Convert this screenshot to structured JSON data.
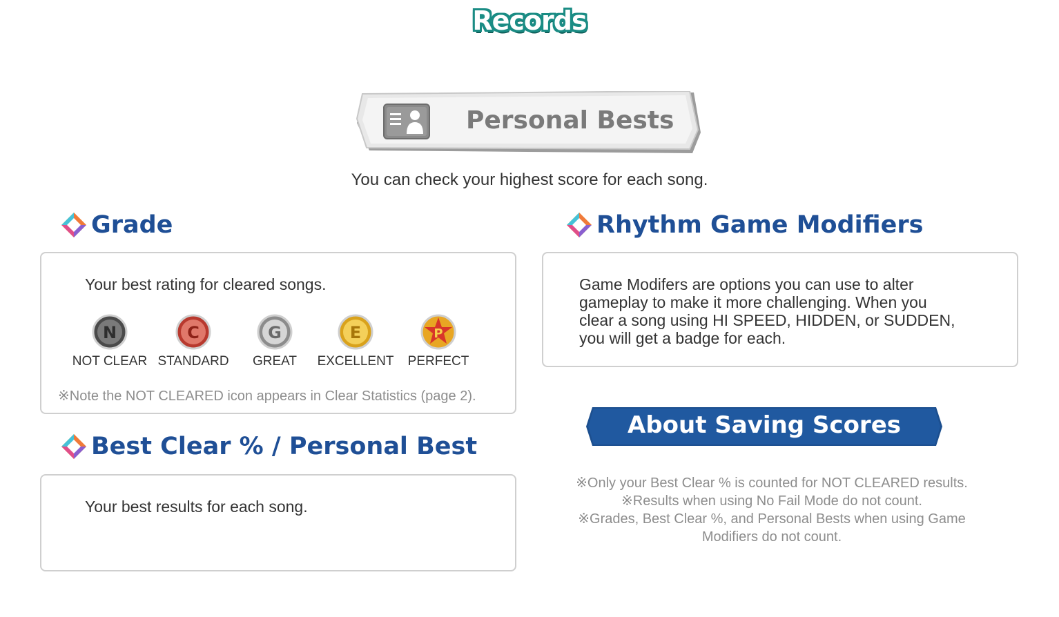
{
  "header": {
    "title": "Records"
  },
  "personal_bests": {
    "banner_label": "Personal Bests",
    "icon": "profile-card-icon",
    "subtitle": "You can check your highest score for each song."
  },
  "grade": {
    "heading": "Grade",
    "description": "Your best rating for cleared songs.",
    "badges": [
      {
        "letter": "N",
        "label": "NOT CLEAR",
        "color": "#5f5f5f"
      },
      {
        "letter": "C",
        "label": "STANDARD",
        "color": "#c94a3c"
      },
      {
        "letter": "G",
        "label": "GREAT",
        "color": "#9a9a9a"
      },
      {
        "letter": "E",
        "label": "EXCELLENT",
        "color": "#e0b22a"
      },
      {
        "letter": "P",
        "label": "PERFECT",
        "color": "#e8a623"
      }
    ],
    "note": "※Note the NOT CLEARED icon appears in Clear Statistics (page 2)."
  },
  "best_clear": {
    "heading": "Best Clear % / Personal Best",
    "description": "Your best results for each song."
  },
  "modifiers": {
    "heading": "Rhythm Game Modifiers",
    "description_lines": [
      "Game Modifers are options you can use to alter",
      "gameplay to make it more challenging. When you",
      "clear a song using HI SPEED, HIDDEN, or SUDDEN,",
      "you will get a badge for each."
    ]
  },
  "saving": {
    "banner_label": "About Saving Scores",
    "notes": [
      "※Only your Best Clear % is counted for NOT CLEARED results.",
      "※Results when using No Fail Mode do not count.",
      "※Grades, Best Clear %, and Personal Bests when using Game",
      "Modifiers do not count."
    ]
  },
  "colors": {
    "heading_blue": "#1f4f96",
    "banner_blue": "#2059a0",
    "records_teal": "#1a8c84",
    "note_gray": "#8d8d8d"
  }
}
